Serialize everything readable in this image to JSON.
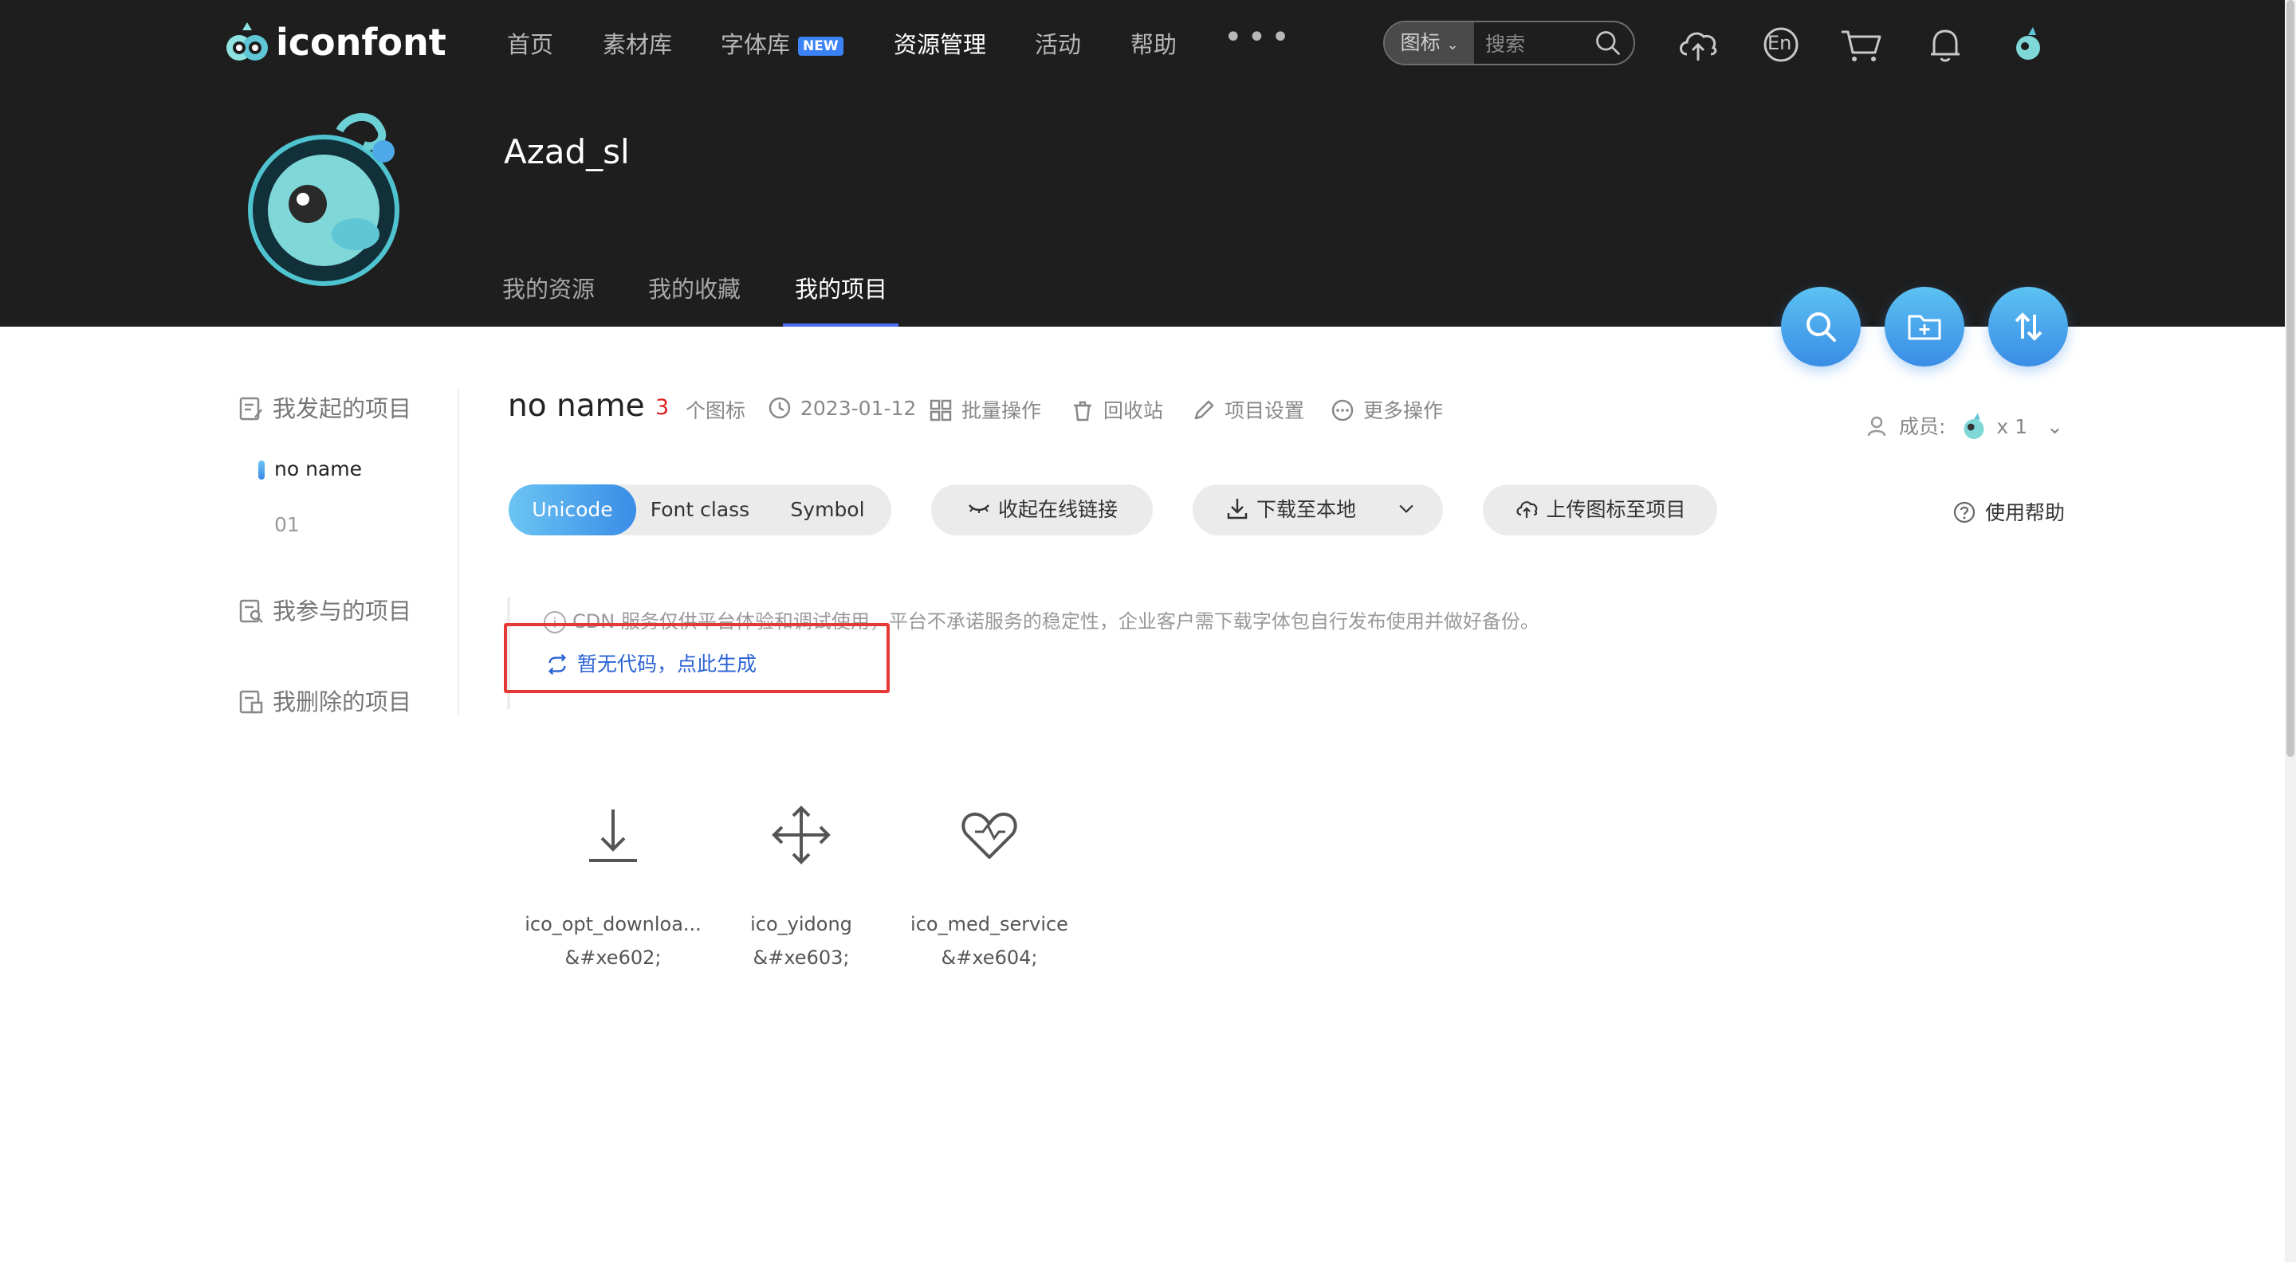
{
  "header": {
    "logo_text": "iconfont",
    "nav": [
      "首页",
      "素材库",
      "字体库",
      "资源管理",
      "活动",
      "帮助"
    ],
    "new_badge": "NEW",
    "more": "•••",
    "search": {
      "type": "图标",
      "placeholder": "搜索"
    },
    "lang_label": "En"
  },
  "profile": {
    "username": "Azad_sl",
    "tabs": [
      "我的资源",
      "我的收藏",
      "我的项目"
    ]
  },
  "sidebar": {
    "initiated": "我发起的项目",
    "projects": [
      "no name",
      "01"
    ],
    "participated": "我参与的项目",
    "deleted": "我删除的项目"
  },
  "project": {
    "title": "no name",
    "count": "3",
    "count_unit": "个图标",
    "date": "2023-01-12",
    "actions": [
      "批量操作",
      "回收站",
      "项目设置",
      "更多操作"
    ],
    "members_label": "成员:",
    "members_count": "x 1",
    "code_tabs": [
      "Unicode",
      "Font class",
      "Symbol"
    ],
    "collapse_link": "收起在线链接",
    "download_local": "下载至本地",
    "upload_icons": "上传图标至项目",
    "help": "使用帮助",
    "notice": "CDN 服务仅供平台体验和调试使用，平台不承诺服务的稳定性，企业客户需下载字体包自行发布使用并做好备份。",
    "generate_link": "暂无代码，点此生成"
  },
  "icons": [
    {
      "name": "ico_opt_downloa...",
      "code": "&#xe602;",
      "icon": "download-arrow-icon"
    },
    {
      "name": "ico_yidong",
      "code": "&#xe603;",
      "icon": "move-arrows-icon"
    },
    {
      "name": "ico_med_service",
      "code": "&#xe604;",
      "icon": "heart-icon"
    }
  ],
  "colors": {
    "header_bg": "#1e1e1e",
    "accent_blue": "#3a8ce6",
    "count_red": "#e02424",
    "highlight_red": "#e53935",
    "link_blue": "#2c64d6"
  }
}
